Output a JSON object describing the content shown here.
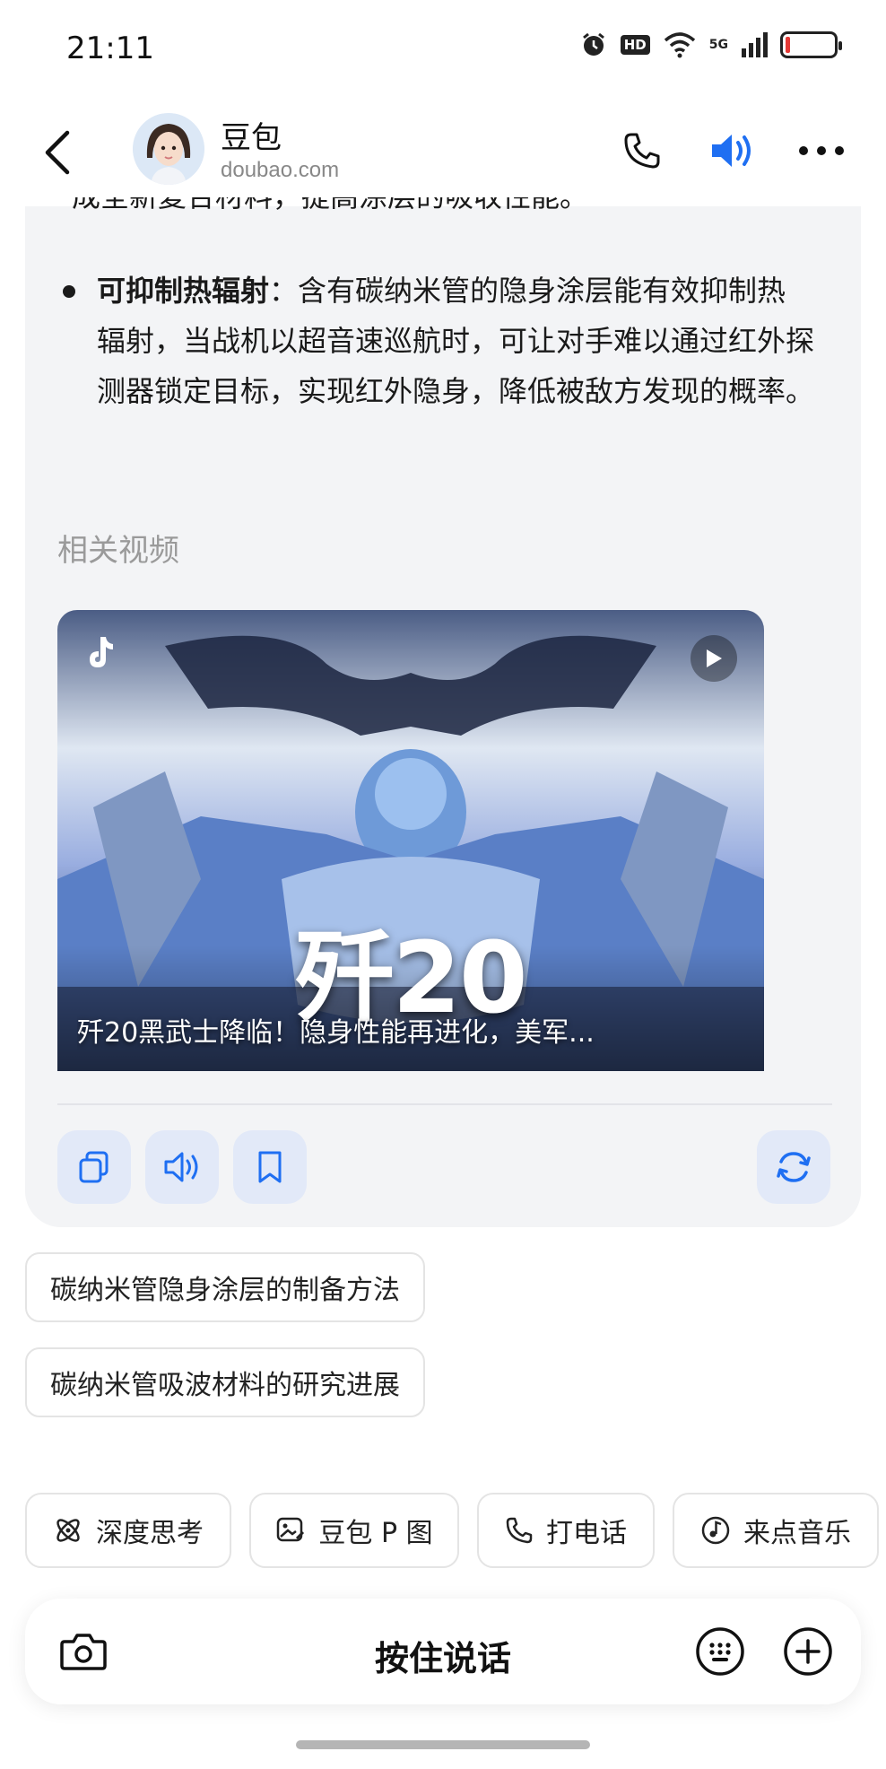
{
  "status_bar": {
    "time": "21:11",
    "hd_label": "HD",
    "network_label": "5G",
    "battery_level": 0.1,
    "battery_color": "#e53935"
  },
  "header": {
    "title": "豆包",
    "subtitle": "doubao.com",
    "icons": [
      "back-arrow-icon",
      "avatar",
      "phone-icon",
      "speaker-icon",
      "more-icon"
    ],
    "accent_color": "#1f6ff2"
  },
  "message": {
    "clipped_line": "成全新复合材料，提高涂层的吸收性能。",
    "bullet_bold": "可抑制热辐射",
    "bullet_text": "：含有碳纳米管的隐身涂层能有效抑制热辐射，当战机以超音速巡航时，可让对手难以通过红外探测器锁定目标，实现红外隐身，降低被敌方发现的概率。",
    "related_label": "相关视频",
    "video": {
      "overlay_title": "歼20",
      "caption": "歼20黑武士降临！隐身性能再进化，美军..."
    },
    "actions": [
      "copy-icon",
      "read-aloud-icon",
      "bookmark-icon",
      "regenerate-icon"
    ]
  },
  "suggestions": [
    "碳纳米管隐身涂层的制备方法",
    "碳纳米管吸波材料的研究进展"
  ],
  "tools": [
    {
      "label": "深度思考",
      "icon": "atom-icon"
    },
    {
      "label": "豆包 P 图",
      "icon": "image-edit-icon"
    },
    {
      "label": "打电话",
      "icon": "phone-icon"
    },
    {
      "label": "来点音乐",
      "icon": "music-icon"
    }
  ],
  "input": {
    "hold_to_talk": "按住说话"
  }
}
